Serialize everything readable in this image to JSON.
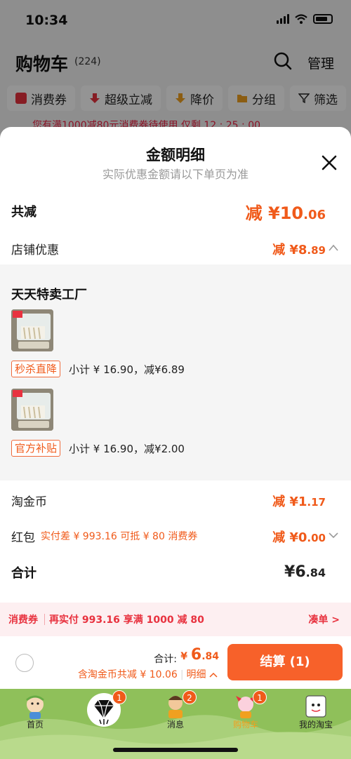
{
  "status_bar": {
    "time": "10:34"
  },
  "cart_header": {
    "title": "购物车",
    "count": "(224)",
    "manage_label": "管理"
  },
  "filters": [
    {
      "label": "消费券",
      "icon": "coupon-icon",
      "color": "#e8323f"
    },
    {
      "label": "超级立减",
      "icon": "arrow-down-icon",
      "color": "#e8323f"
    },
    {
      "label": "降价",
      "icon": "arrow-down-icon",
      "color": "#f0a020"
    },
    {
      "label": "分组",
      "icon": "folder-icon",
      "color": "#f0a020"
    }
  ],
  "filter_label": "筛选",
  "notice": "您有满1000减80元消费券待使用 仅剩 12 : 25 : 00",
  "sheet": {
    "title": "金额明细",
    "subtitle": "实际优惠金额请以下单页为准",
    "total_discount": {
      "label": "共减",
      "prefix": "减 ¥",
      "int": "10",
      "dec": ".06"
    },
    "shop_discount": {
      "label": "店铺优惠",
      "prefix": "减 ¥",
      "int": "8",
      "dec": ".89"
    },
    "store": {
      "name": "天天特卖工厂",
      "items": [
        {
          "tag": "秒杀直降",
          "detail": "小计 ¥ 16.90，减¥6.89"
        },
        {
          "tag": "官方补贴",
          "detail": "小计 ¥ 16.90，减¥2.00"
        }
      ]
    },
    "taojinbi": {
      "label": "淘金币",
      "prefix": "减 ¥",
      "int": "1",
      "dec": ".17"
    },
    "red_packet": {
      "label": "红包",
      "note": "实付差 ¥ 993.16 可抵 ¥ 80 消费券",
      "prefix": "减 ¥",
      "int": "0",
      "dec": ".00"
    },
    "subtotal": {
      "label": "合计",
      "prefix": "¥",
      "int": "6",
      "dec": ".84"
    },
    "coupon_bar": {
      "tag": "消费券",
      "text": "再实付 993.16 享满 1000 减 80",
      "link": "凑单 >"
    }
  },
  "checkout": {
    "total_label": "合计:",
    "total_prefix": "¥ ",
    "total_int": "6",
    "total_dec": ".84",
    "sub_text": "含淘金币共减 ¥ 10.06",
    "detail_link": "明细",
    "button": "结算 (1)"
  },
  "tabbar": [
    {
      "label": "首页",
      "badge": ""
    },
    {
      "label": "",
      "badge": "1"
    },
    {
      "label": "消息",
      "badge": "2"
    },
    {
      "label": "购物车",
      "badge": "1"
    },
    {
      "label": "我的淘宝",
      "badge": ""
    }
  ],
  "colors": {
    "accent": "#f05a1a",
    "coupon_red": "#e8323f",
    "tab_green": "#8fc05a"
  }
}
